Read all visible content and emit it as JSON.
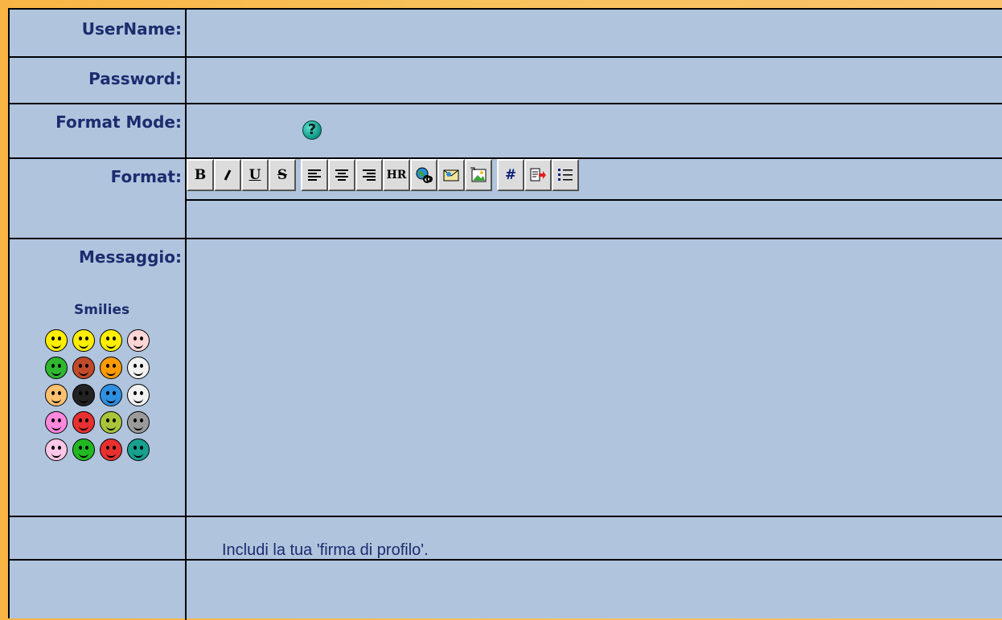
{
  "form": {
    "username_label": "UserName:",
    "password_label": "Password:",
    "format_mode_label": "Format Mode:",
    "format_label": "Format:",
    "message_label": "Messaggio:",
    "smilies_title": "Smilies",
    "signature_text": "Includi la tua 'firma di profilo'.",
    "help_icon_glyph": "?"
  },
  "toolbar": {
    "groups": [
      [
        {
          "name": "bold-button",
          "text": "B"
        },
        {
          "name": "italic-button",
          "icon": "italic-icon"
        },
        {
          "name": "underline-button",
          "text": "U"
        },
        {
          "name": "strikethrough-button",
          "text": "S"
        }
      ],
      [
        {
          "name": "align-left-button",
          "icon": "align-left-icon"
        },
        {
          "name": "align-center-button",
          "icon": "align-center-icon"
        },
        {
          "name": "align-right-button",
          "icon": "align-right-icon"
        },
        {
          "name": "horizontal-rule-button",
          "text": "HR"
        },
        {
          "name": "insert-link-button",
          "icon": "globe-link-icon"
        },
        {
          "name": "insert-email-button",
          "icon": "email-icon"
        },
        {
          "name": "insert-image-button",
          "icon": "image-icon"
        }
      ],
      [
        {
          "name": "insert-code-button",
          "text": "#"
        },
        {
          "name": "insert-quote-button",
          "icon": "quote-icon"
        },
        {
          "name": "insert-list-button",
          "icon": "list-icon"
        }
      ]
    ]
  },
  "smilies": [
    {
      "name": "smile",
      "color": "#ffee00"
    },
    {
      "name": "big-grin",
      "color": "#ffee00"
    },
    {
      "name": "cool",
      "color": "#ffee00"
    },
    {
      "name": "blush",
      "color": "#ffd6d6"
    },
    {
      "name": "tongue",
      "color": "#2fb82f"
    },
    {
      "name": "evil",
      "color": "#c04a2a"
    },
    {
      "name": "wink",
      "color": "#ff9a00"
    },
    {
      "name": "clown",
      "color": "#f2f2f2"
    },
    {
      "name": "shy",
      "color": "#ffc070"
    },
    {
      "name": "eight-ball",
      "color": "#222222"
    },
    {
      "name": "sad",
      "color": "#2f8fe0"
    },
    {
      "name": "shock",
      "color": "#f2f2f2"
    },
    {
      "name": "surprised",
      "color": "#ff88dd"
    },
    {
      "name": "angry",
      "color": "#e83030"
    },
    {
      "name": "dead",
      "color": "#a8c43a"
    },
    {
      "name": "sleepy",
      "color": "#9a9a9a"
    },
    {
      "name": "kisses",
      "color": "#ffc8e8"
    },
    {
      "name": "disapprove",
      "color": "#22b822"
    },
    {
      "name": "cry",
      "color": "#e83030"
    },
    {
      "name": "question",
      "color": "#18a08e"
    }
  ],
  "colors": {
    "panel": "#b0c4de",
    "label_text": "#1c2c6e",
    "background": "#f8b544"
  }
}
